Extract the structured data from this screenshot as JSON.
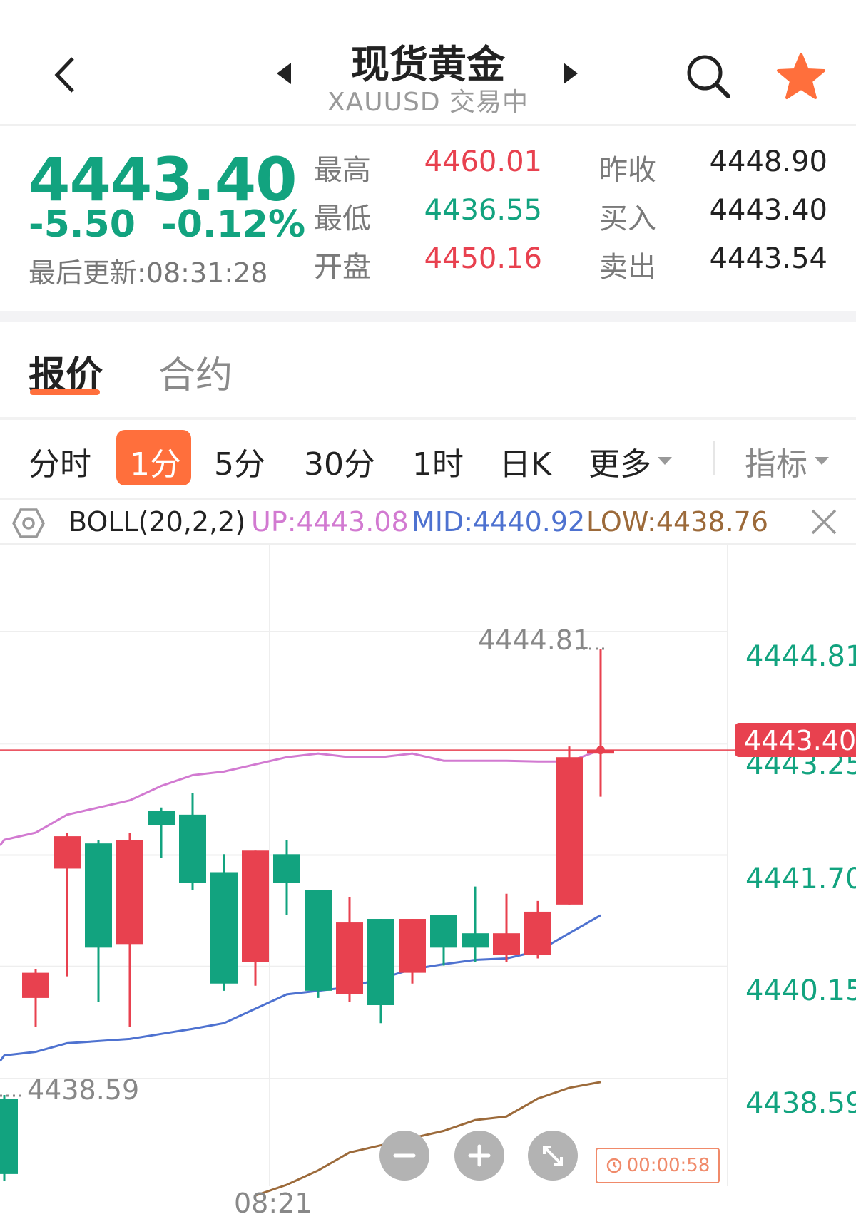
{
  "header": {
    "title": "现货黄金",
    "subtitle": "XAUUSD 交易中"
  },
  "quote": {
    "price": "4443.40",
    "change": "-5.50",
    "change_pct": "-0.12%",
    "last_update": "最后更新:08:31:28",
    "high_label": "最高",
    "high": "4460.01",
    "low_label": "最低",
    "low": "4436.55",
    "open_label": "开盘",
    "open": "4450.16",
    "prev_close_label": "昨收",
    "prev_close": "4448.90",
    "bid_label": "买入",
    "bid": "4443.40",
    "ask_label": "卖出",
    "ask": "4443.54"
  },
  "tabs": [
    "报价",
    "合约"
  ],
  "periods": [
    "分时",
    "1分",
    "5分",
    "30分",
    "1时",
    "日K",
    "更多"
  ],
  "selected_period": "1分",
  "indicator_label": "指标",
  "boll": {
    "name": "BOLL(20,2,2)",
    "up": "UP:4443.08",
    "mid": "MID:4440.92",
    "low": "LOW:4438.76"
  },
  "colors": {
    "up_candle": "#e8414f",
    "down_candle": "#12a37f",
    "accent": "#ff6f3c",
    "boll_up": "#d27ad1",
    "boll_mid": "#4e72d0",
    "boll_low": "#9c6a3a"
  },
  "chart": {
    "y_labels": [
      "4444.81",
      "4443.25",
      "4441.70",
      "4440.15",
      "4438.59"
    ],
    "current_price_tag": "4443.40",
    "max_marker": "4444.81",
    "min_marker": "4438.59",
    "time_label": "08:21",
    "countdown": "00:00:58",
    "candles": [
      {
        "o": 4438.55,
        "h": 4438.6,
        "l": 4437.4,
        "c": 4437.5
      },
      {
        "o": 4439.95,
        "h": 4440.35,
        "l": 4439.55,
        "c": 4440.3
      },
      {
        "o": 4441.75,
        "h": 4442.25,
        "l": 4440.25,
        "c": 4442.2
      },
      {
        "o": 4442.1,
        "h": 4442.15,
        "l": 4439.9,
        "c": 4440.65
      },
      {
        "o": 4440.7,
        "h": 4442.25,
        "l": 4439.55,
        "c": 4442.15
      },
      {
        "o": 4442.55,
        "h": 4442.6,
        "l": 4441.9,
        "c": 4442.35
      },
      {
        "o": 4442.5,
        "h": 4442.8,
        "l": 4441.45,
        "c": 4441.55
      },
      {
        "o": 4441.7,
        "h": 4441.95,
        "l": 4440.05,
        "c": 4440.15
      },
      {
        "o": 4440.45,
        "h": 4442.0,
        "l": 4440.12,
        "c": 4442.0
      },
      {
        "o": 4441.95,
        "h": 4442.15,
        "l": 4441.1,
        "c": 4441.55
      },
      {
        "o": 4441.45,
        "h": 4441.45,
        "l": 4439.95,
        "c": 4440.05
      },
      {
        "o": 4440.0,
        "h": 4441.35,
        "l": 4439.9,
        "c": 4441.0
      },
      {
        "o": 4441.05,
        "h": 4441.05,
        "l": 4439.6,
        "c": 4439.85
      },
      {
        "o": 4440.3,
        "h": 4441.05,
        "l": 4440.15,
        "c": 4441.05
      },
      {
        "o": 4441.1,
        "h": 4441.1,
        "l": 4440.4,
        "c": 4440.65
      },
      {
        "o": 4440.85,
        "h": 4441.5,
        "l": 4440.45,
        "c": 4440.65
      },
      {
        "o": 4440.55,
        "h": 4441.4,
        "l": 4440.45,
        "c": 4440.85
      },
      {
        "o": 4440.55,
        "h": 4441.3,
        "l": 4440.5,
        "c": 4441.15
      },
      {
        "o": 4441.25,
        "h": 4443.45,
        "l": 4441.25,
        "c": 4443.3
      },
      {
        "o": 4443.35,
        "h": 4444.81,
        "l": 4442.75,
        "c": 4443.4
      }
    ],
    "boll_up": [
      4442.15,
      4442.25,
      4442.5,
      4442.6,
      4442.7,
      4442.9,
      4443.05,
      4443.1,
      4443.2,
      4443.3,
      4443.35,
      4443.3,
      4443.3,
      4443.35,
      4443.25,
      4443.25,
      4443.25,
      4443.24,
      4443.24,
      4443.4
    ],
    "boll_mid": [
      4439.15,
      4439.2,
      4439.32,
      4439.35,
      4439.38,
      4439.45,
      4439.52,
      4439.6,
      4439.8,
      4440.0,
      4440.05,
      4440.1,
      4440.22,
      4440.35,
      4440.42,
      4440.48,
      4440.5,
      4440.6,
      4440.85,
      4441.1
    ],
    "boll_low": [
      null,
      null,
      null,
      null,
      null,
      null,
      null,
      null,
      4437.2,
      4437.35,
      4437.55,
      4437.8,
      4437.9,
      4438.0,
      4438.1,
      4438.25,
      4438.3,
      4438.55,
      4438.7,
      4438.78
    ]
  },
  "zoom_out_icon": "minus-icon",
  "zoom_in_icon": "plus-icon",
  "fullscreen_icon": "expand-icon"
}
